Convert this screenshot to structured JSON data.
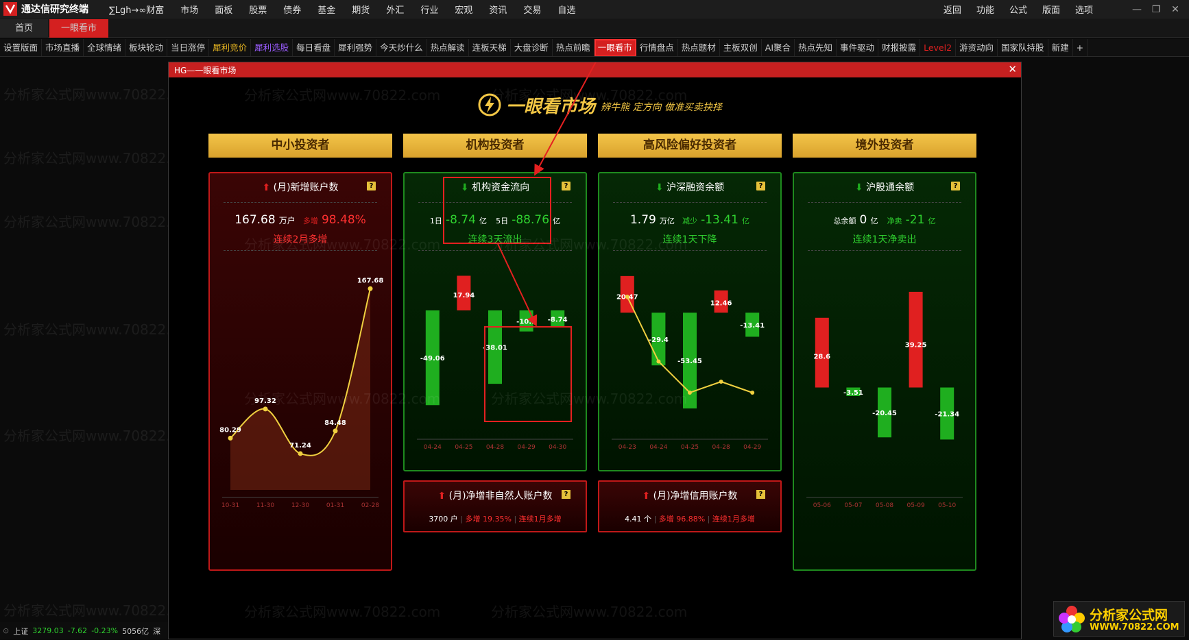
{
  "app": {
    "title": "通达信研究终端",
    "menu": [
      "∑Lgh→∞财富",
      "市场",
      "面板",
      "股票",
      "债券",
      "基金",
      "期货",
      "外汇",
      "行业",
      "宏观",
      "资讯",
      "交易",
      "自选"
    ],
    "right_menu": [
      "返回",
      "功能",
      "公式",
      "版面",
      "选项"
    ]
  },
  "tabs": {
    "home": "首页",
    "active": "一眼看市"
  },
  "toolbar": [
    {
      "label": "设置版面",
      "style": ""
    },
    {
      "label": "市场直播",
      "style": ""
    },
    {
      "label": "全球情绪",
      "style": ""
    },
    {
      "label": "板块轮动",
      "style": ""
    },
    {
      "label": "当日涨停",
      "style": ""
    },
    {
      "label": "犀利竞价",
      "style": "yellow"
    },
    {
      "label": "犀利选股",
      "style": "purple"
    },
    {
      "label": "每日看盘",
      "style": ""
    },
    {
      "label": "犀利强势",
      "style": ""
    },
    {
      "label": "今天炒什么",
      "style": ""
    },
    {
      "label": "热点解读",
      "style": ""
    },
    {
      "label": "连板天梯",
      "style": ""
    },
    {
      "label": "大盘诊断",
      "style": ""
    },
    {
      "label": "热点前瞻",
      "style": ""
    },
    {
      "label": "一眼看市",
      "style": "selected"
    },
    {
      "label": "行情盘点",
      "style": ""
    },
    {
      "label": "热点题材",
      "style": ""
    },
    {
      "label": "主板双创",
      "style": ""
    },
    {
      "label": "AI聚合",
      "style": ""
    },
    {
      "label": "热点先知",
      "style": ""
    },
    {
      "label": "事件驱动",
      "style": ""
    },
    {
      "label": "财报披露",
      "style": ""
    },
    {
      "label": "Level2",
      "style": "red"
    },
    {
      "label": "游资动向",
      "style": ""
    },
    {
      "label": "国家队持股",
      "style": ""
    },
    {
      "label": "新建",
      "style": ""
    },
    {
      "label": "+",
      "style": ""
    }
  ],
  "panel": {
    "title": "HG—一眼看市场",
    "close": "✕",
    "brand": "一眼看市场",
    "slogan": "辨牛熊 定方向 做准买卖抉择"
  },
  "columns": [
    "中小投资者",
    "机构投资者",
    "高风险偏好投资者",
    "境外投资者"
  ],
  "cards": {
    "retail": {
      "title": "(月)新增账户数",
      "value": "167.68",
      "unit": "万户",
      "change_label": "多增",
      "change": "98.48%",
      "trend": "连续2月多增",
      "chart_data": {
        "type": "area",
        "categories": [
          "10-31",
          "11-30",
          "12-30",
          "01-31",
          "02-28"
        ],
        "values": [
          80.29,
          97.32,
          71.24,
          84.48,
          167.68
        ],
        "ylim": [
          60,
          175
        ]
      }
    },
    "institution": {
      "title": "机构资金流向",
      "d1_label": "1日",
      "d1_value": "-8.74",
      "d1_unit": "亿",
      "d5_label": "5日",
      "d5_value": "-88.76",
      "d5_unit": "亿",
      "trend": "连续3天流出",
      "chart_data": {
        "type": "bar",
        "categories": [
          "04-24",
          "04-25",
          "04-28",
          "04-29",
          "04-30"
        ],
        "series": [
          {
            "values": [
              -49.06,
              -38.01,
              -10.9,
              -8.74
            ]
          },
          {
            "values": [
              17.94
            ]
          }
        ],
        "bars": [
          {
            "x": "04-24",
            "value": -49.06
          },
          {
            "x": "04-25",
            "value": 17.94
          },
          {
            "x": "04-28",
            "value": -38.01
          },
          {
            "x": "04-29",
            "value": -10.9
          },
          {
            "x": "04-30",
            "value": -8.74
          }
        ],
        "ylim": [
          -55,
          22
        ]
      }
    },
    "margin": {
      "title": "沪深融资余额",
      "value": "1.79",
      "unit": "万亿",
      "change_label": "减少",
      "change": "-13.41",
      "change_unit": "亿",
      "trend": "连续1天下降",
      "chart_data": {
        "type": "bar",
        "categories": [
          "04-23",
          "04-24",
          "04-25",
          "04-28",
          "04-29"
        ],
        "bars": [
          {
            "x": "04-23",
            "value": 20.47
          },
          {
            "x": "04-24",
            "value": -29.4
          },
          {
            "x": "04-25",
            "value": -53.45
          },
          {
            "x": "04-28",
            "value": 12.46
          },
          {
            "x": "04-29",
            "value": -13.41
          }
        ],
        "ylim": [
          -58,
          25
        ]
      }
    },
    "foreign": {
      "title": "沪股通余额",
      "total_label": "总余额",
      "total": "0",
      "total_unit": "亿",
      "net_label": "净卖",
      "net": "-21",
      "net_unit": "亿",
      "trend": "连续1天净卖出",
      "chart_data": {
        "type": "bar",
        "categories": [
          "05-06",
          "05-07",
          "05-08",
          "05-09",
          "05-10"
        ],
        "bars": [
          {
            "x": "05-06",
            "value": 28.6
          },
          {
            "x": "05-07",
            "value": -3.51
          },
          {
            "x": "05-08",
            "value": -20.45
          },
          {
            "x": "05-09",
            "value": 39.25
          },
          {
            "x": "05-10",
            "value": -21.34
          }
        ],
        "ylim": [
          -26,
          44
        ]
      }
    },
    "nonnatural": {
      "title": "(月)净增非自然人账户数",
      "value": "3700 户",
      "change": "多增 19.35%",
      "trend": "连续1月多增"
    },
    "credit": {
      "title": "(月)净增信用账户数",
      "value": "4.41 个",
      "change": "多增 96.88%",
      "trend": "连续1月多增"
    }
  },
  "statusbar": {
    "index_name": "上证",
    "index_value": "3279.03",
    "index_change": "-7.62",
    "index_pct": "-0.23%",
    "turnover": "5056亿",
    "next": "深"
  },
  "watermark": {
    "text": "分析家公式网www.70822.com",
    "logo_cn": "分析家公式网",
    "logo_url": "WWW.70822.COM"
  },
  "colors": {
    "red": "#e02020",
    "green": "#1fae1f",
    "gold": "#f3c745",
    "line": "#f0d040"
  }
}
